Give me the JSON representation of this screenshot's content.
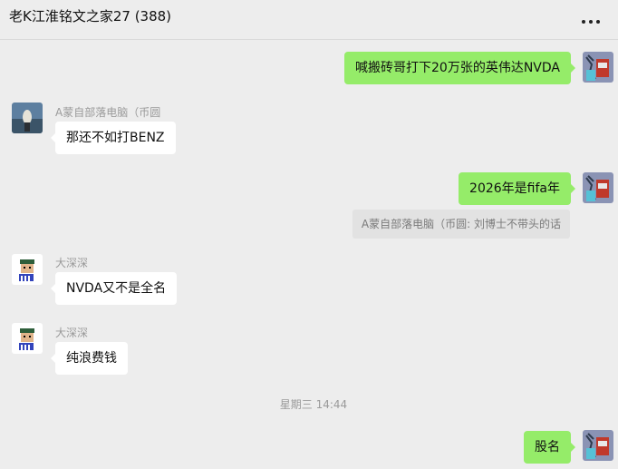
{
  "header": {
    "title": "老K江淮铭文之家27 (388)",
    "more_icon": "more-horizontal-icon"
  },
  "messages": [
    {
      "direction": "out",
      "text": "喊搬砖哥打下20万张的英伟达NVDA"
    },
    {
      "direction": "in",
      "sender": "A蒙自部落电脑（币圆",
      "text": "那还不如打BENZ"
    },
    {
      "direction": "out",
      "text": "2026年是fifa年",
      "quote": "A蒙自部落电脑（币圆: 刘博士不带头的话"
    },
    {
      "direction": "in",
      "sender": "大深深",
      "text": "NVDA又不是全名"
    },
    {
      "direction": "in",
      "sender": "大深深",
      "text": "纯浪费钱"
    },
    {
      "direction": "out",
      "text": "股名"
    }
  ],
  "timestamp": "星期三 14:44",
  "colors": {
    "background": "#ededed",
    "outgoing_bubble": "#95ec69",
    "incoming_bubble": "#ffffff"
  }
}
